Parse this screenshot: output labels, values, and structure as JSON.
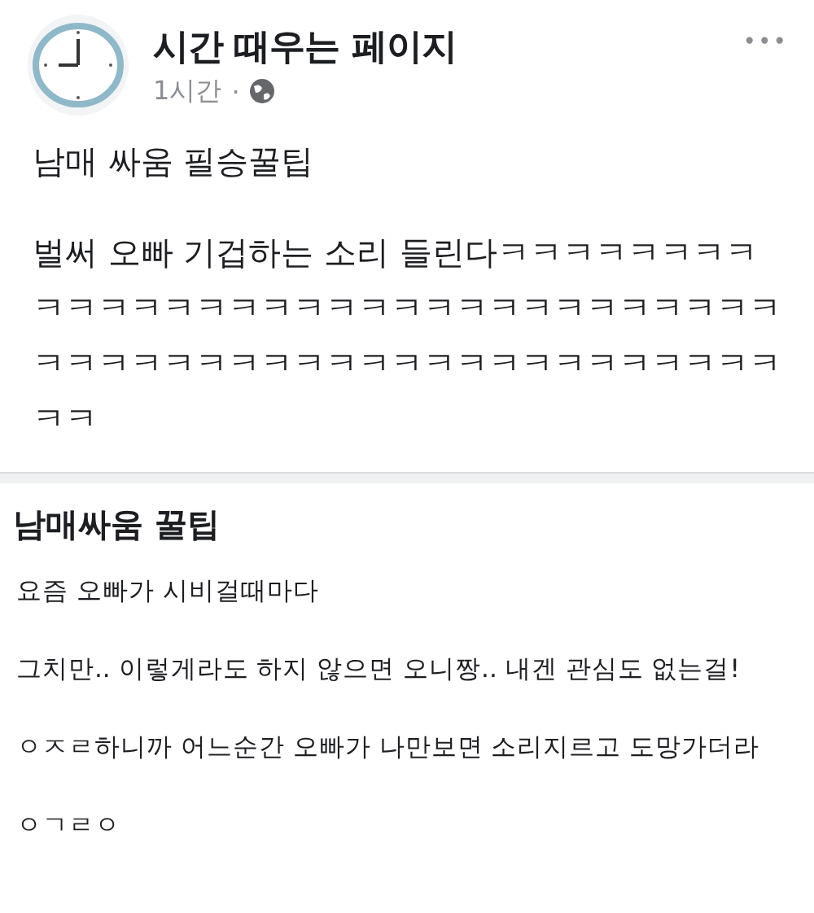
{
  "post": {
    "page_name": "시간 때우는 페이지",
    "time": "1시간",
    "separator": "·",
    "more": "•••",
    "paragraphs": [
      "남매 싸움 필승꿀팁",
      "벌써 오빠 기겁하는 소리 들린다ㅋㅋㅋㅋㅋㅋㅋㅋㅋㅋㅋㅋㅋㅋㅋㅋㅋㅋㅋㅋㅋㅋㅋㅋㅋㅋㅋㅋㅋㅋㅋㅋㅋㅋㅋㅋㅋㅋㅋㅋㅋㅋㅋㅋㅋㅋㅋㅋㅋㅋㅋㅋㅋㅋㅋㅋ"
    ]
  },
  "attachment": {
    "title": "남매싸움 꿀팁",
    "paragraphs": [
      "요즘 오빠가 시비걸때마다",
      "그치만.. 이렇게라도 하지 않으면 오니짱.. 내겐 관심도 없는걸!",
      "ㅇㅈㄹ하니까 어느순간 오빠가 나만보면 소리지르고 도망가더라",
      "ㅇㄱㄹㅇ"
    ]
  }
}
